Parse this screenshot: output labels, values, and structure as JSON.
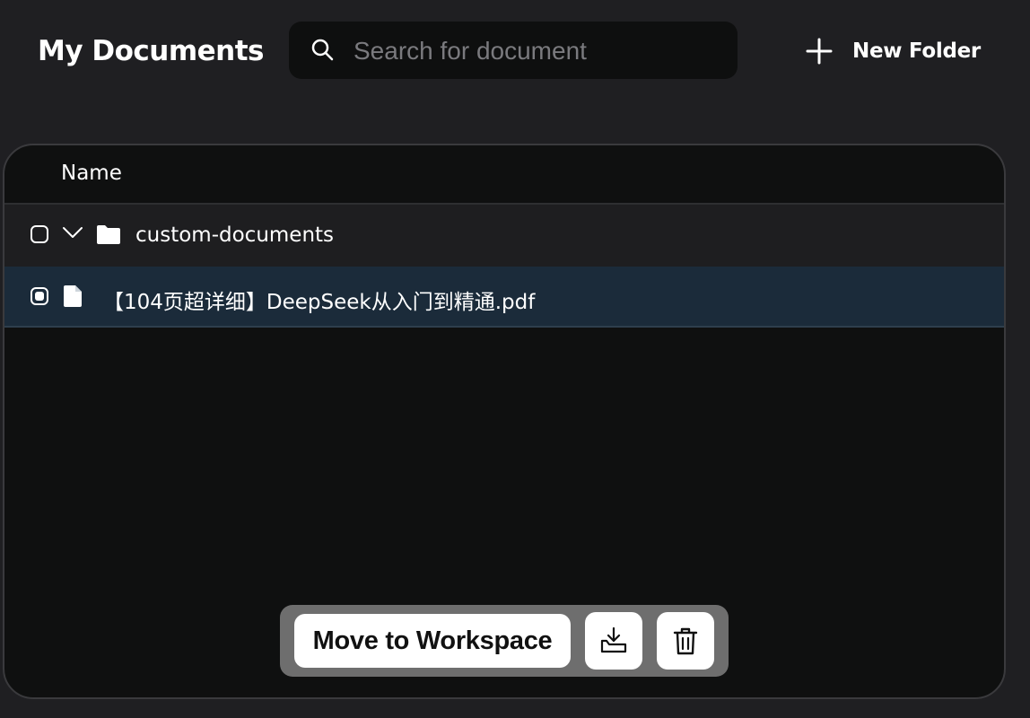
{
  "header": {
    "title": "My Documents",
    "search_placeholder": "Search for document",
    "search_value": "",
    "new_folder_label": "New Folder"
  },
  "table": {
    "columns": [
      "Name"
    ],
    "rows": [
      {
        "type": "folder",
        "name": "custom-documents",
        "expanded": true,
        "selected": false,
        "icon": "folder-icon"
      },
      {
        "type": "file",
        "name": "【104页超详细】DeepSeek从入门到精通.pdf",
        "selected": true,
        "icon": "file-icon"
      }
    ]
  },
  "actions": {
    "move_label": "Move to Workspace",
    "embed_icon": "download-tray-icon",
    "delete_icon": "trash-icon"
  },
  "colors": {
    "background": "#1f1f22",
    "panel": "#0f1010",
    "selected_row": "#1b2b3a",
    "action_bar": "#6e6e6e",
    "text": "#ffffff",
    "placeholder": "#7a7a7e"
  }
}
